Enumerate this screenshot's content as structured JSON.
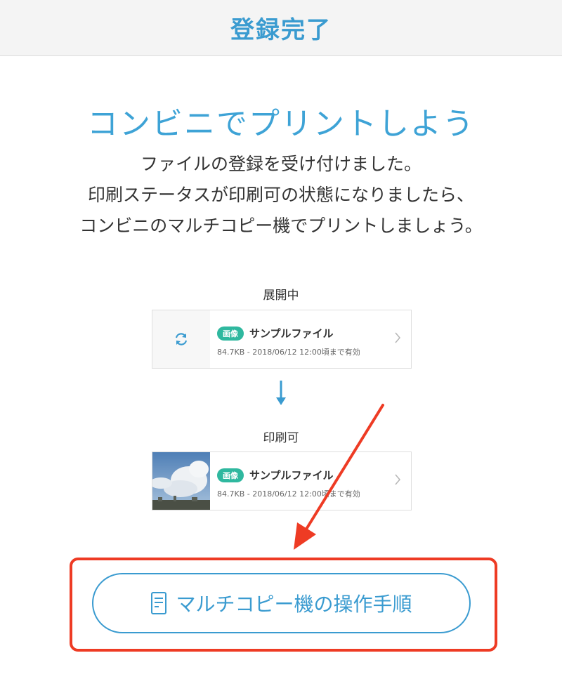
{
  "header": {
    "title": "登録完了"
  },
  "main": {
    "headline": "コンビニでプリントしよう",
    "description_lines": [
      "ファイルの登録を受け付けました。",
      "印刷ステータスが印刷可の状態になりましたら、",
      "コンビニのマルチコピー機でプリントしましょう。"
    ]
  },
  "steps": [
    {
      "status_label": "展開中",
      "badge": "画像",
      "file_name": "サンプルファイル",
      "meta": "84.7KB - 2018/06/12 12:00頃まで有効",
      "icon": "refresh-icon"
    },
    {
      "status_label": "印刷可",
      "badge": "画像",
      "file_name": "サンプルファイル",
      "meta": "84.7KB - 2018/06/12 12:00頃まで有効",
      "icon": "photo-thumbnail"
    }
  ],
  "guide_button": {
    "label": "マルチコピー機の操作手順",
    "icon": "document-icon"
  },
  "colors": {
    "accent": "#3a9bd0",
    "badge": "#2fb89f",
    "annotation": "#ee3b24"
  }
}
